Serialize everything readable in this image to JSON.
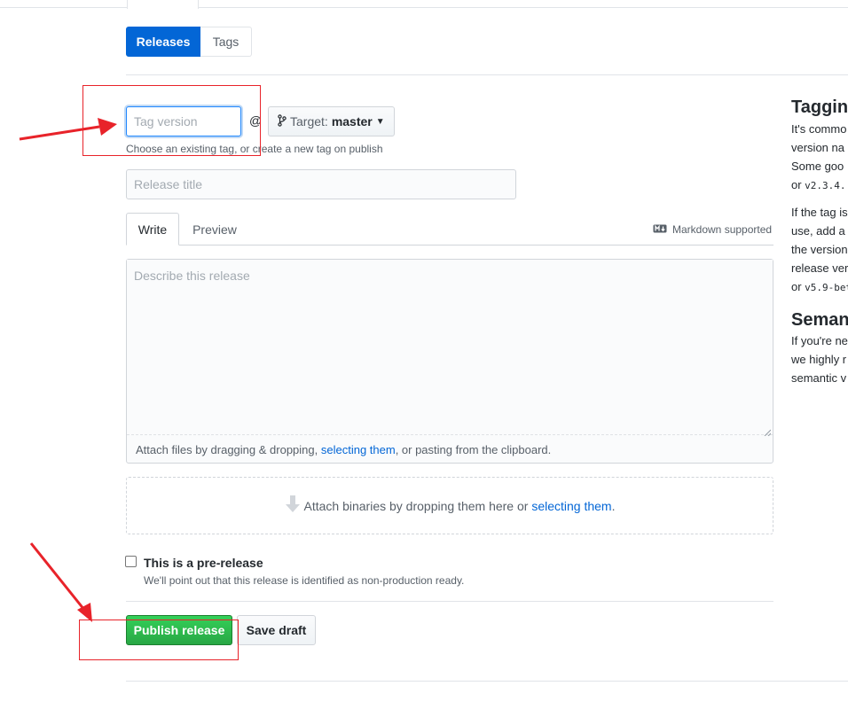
{
  "tabs": {
    "releases": "Releases",
    "tags": "Tags"
  },
  "tag": {
    "placeholder": "Tag version",
    "at_symbol": "@",
    "target_label": "Target:",
    "target_value": "master",
    "hint": "Choose an existing tag, or create a new tag on publish"
  },
  "release_title": {
    "placeholder": "Release title"
  },
  "editor": {
    "write_tab": "Write",
    "preview_tab": "Preview",
    "markdown_note": "Markdown supported",
    "description_placeholder": "Describe this release",
    "attach_prefix": "Attach files by dragging & dropping, ",
    "attach_link": "selecting them",
    "attach_suffix": ", or pasting from the clipboard."
  },
  "binaries": {
    "prefix": "Attach binaries by dropping them here or ",
    "link": "selecting them",
    "suffix": "."
  },
  "prerelease": {
    "label": "This is a pre-release",
    "note": "We'll point out that this release is identified as non-production ready."
  },
  "actions": {
    "publish": "Publish release",
    "save_draft": "Save draft"
  },
  "sidebar": {
    "tagging_heading": "Tagging",
    "tagging_lines": [
      "It's commo",
      "version na",
      "Some goo"
    ],
    "tagging_code_prefix": "or ",
    "tagging_code": "v2.3.4.",
    "tag_lines": [
      "If the tag is",
      "use, add a",
      "the version",
      "release ver"
    ],
    "tag_code_prefix": "or ",
    "tag_code": "v5.9-bet",
    "semver_heading": "Semant",
    "semver_lines": [
      "If you're ne",
      "we highly r"
    ],
    "semver_link": "semantic v"
  },
  "colors": {
    "primary": "#0366d6",
    "publish_green": "#28a745",
    "annotation_red": "#e8232a"
  }
}
